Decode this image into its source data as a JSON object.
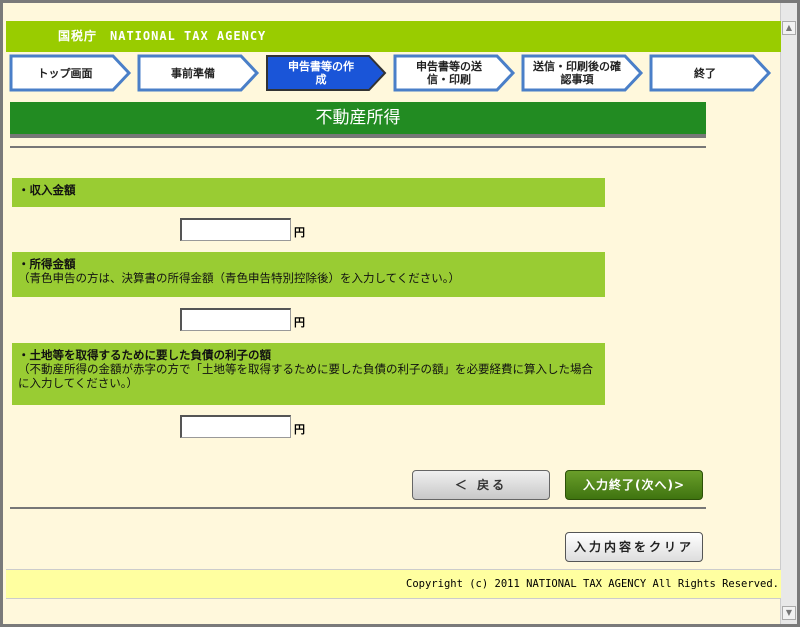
{
  "header": {
    "title": "国税庁　NATIONAL TAX AGENCY"
  },
  "steps": [
    {
      "label": "トップ画面"
    },
    {
      "label": "事前準備"
    },
    {
      "label": "申告書等の作成"
    },
    {
      "label": "申告書等の送信・印刷"
    },
    {
      "label": "送信・印刷後の確認事項"
    },
    {
      "label": "終了"
    }
  ],
  "current_step": "申告書等の作成",
  "page_title": "不動産所得",
  "fields": [
    {
      "label": "・収入金額",
      "note": "",
      "value": "",
      "unit": "円"
    },
    {
      "label": "・所得金額",
      "note": "（青色申告の方は、決算書の所得金額（青色申告特別控除後）を入力してください。）",
      "value": "",
      "unit": "円"
    },
    {
      "label": "・土地等を取得するために要した負債の利子の額",
      "note": "（不動産所得の金額が赤字の方で「土地等を取得するために要した負債の利子の額」を必要経費に算入した場合に入力してください。）",
      "value": "",
      "unit": "円"
    }
  ],
  "buttons": {
    "back": "＜ 戻る",
    "next": "入力終了(次へ)>",
    "clear": "入力内容をクリア"
  },
  "footer": "Copyright (c) 2011 NATIONAL TAX AGENCY All Rights Reserved."
}
